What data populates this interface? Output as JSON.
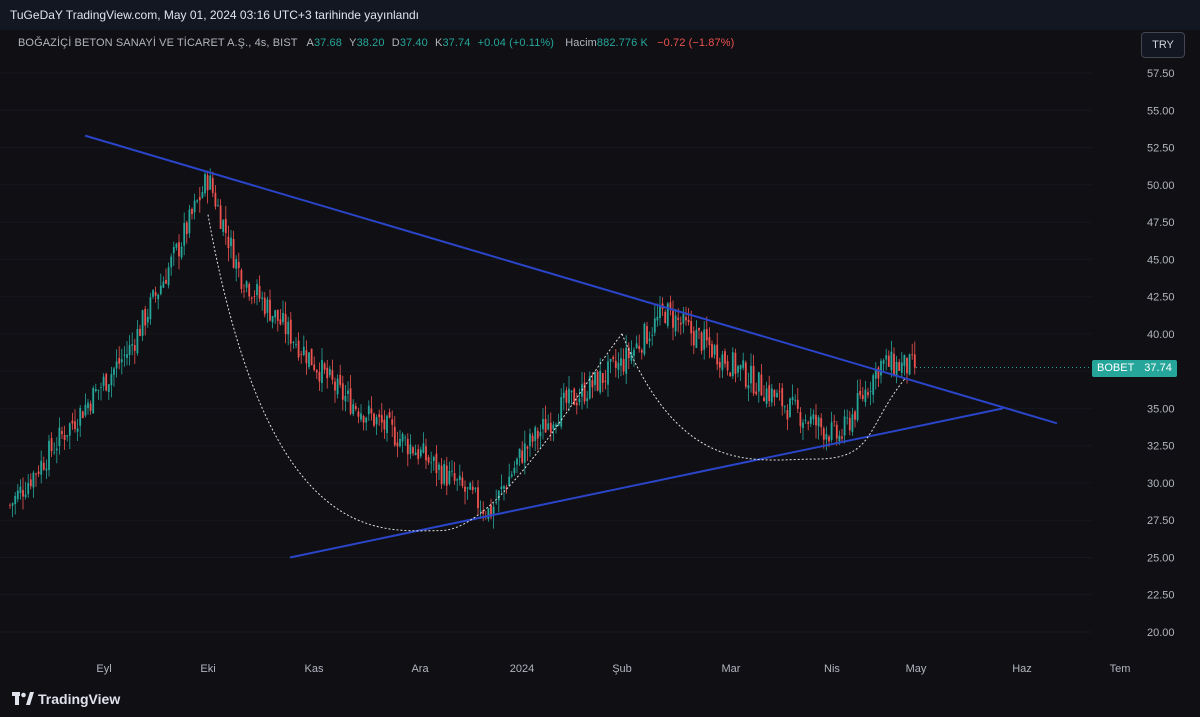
{
  "header": {
    "publish_line": "TuGeDaY TradingView.com, May 01, 2024 03:16 UTC+3 tarihinde yayınlandı"
  },
  "legend": {
    "title": "BOĞAZİÇİ BETON SANAYİ VE TİCARET A.Ş., 4s, BIST",
    "open_label": "A",
    "open_value": "37.68",
    "high_label": "Y",
    "high_value": "38.20",
    "low_label": "D",
    "low_value": "37.40",
    "close_label": "K",
    "close_value": "37.74",
    "change": "+0.04 (+0.11%)",
    "volume_label": "Hacim",
    "volume_value": "882.776 K",
    "volume_change": "−0.72 (−1.87%)"
  },
  "currency_button": "TRY",
  "price_tag": {
    "symbol": "BOBET",
    "price": "37.74"
  },
  "footer": {
    "brand": "TradingView"
  },
  "colors": {
    "background": "#0f0f14",
    "up_candle": "#26a69a",
    "down_candle": "#ef5350",
    "trendline": "#2a45c8",
    "arc": "#e0e0e0"
  },
  "chart_data": {
    "type": "candlestick",
    "symbol": "BOBET",
    "interval": "4s",
    "ylim": [
      18.75,
      58.75
    ],
    "y_ticks": [
      "57.50",
      "55.00",
      "52.50",
      "50.00",
      "47.50",
      "45.00",
      "42.50",
      "40.00",
      "37.50",
      "35.00",
      "32.50",
      "30.00",
      "27.50",
      "25.00",
      "22.50",
      "20.00"
    ],
    "x_ticks": [
      "Eyl",
      "Eki",
      "Kas",
      "Ara",
      "2024",
      "Şub",
      "Mar",
      "Nis",
      "May",
      "Haz",
      "Tem"
    ],
    "price_path": [
      {
        "t": "start",
        "p": 28.5
      },
      {
        "t": "Eyl",
        "p": 33
      },
      {
        "t": "Eyl+",
        "p": 39
      },
      {
        "t": "Eki-",
        "p": 46
      },
      {
        "t": "Eki",
        "p": 50.5
      },
      {
        "t": "Eki+",
        "p": 44
      },
      {
        "t": "Kas",
        "p": 40
      },
      {
        "t": "Kas+",
        "p": 36
      },
      {
        "t": "Ara",
        "p": 32
      },
      {
        "t": "Ara+",
        "p": 28
      },
      {
        "t": "2024",
        "p": 32
      },
      {
        "t": "2024+",
        "p": 35
      },
      {
        "t": "Şub",
        "p": 38
      },
      {
        "t": "Şub+",
        "p": 41.5
      },
      {
        "t": "Mar",
        "p": 38
      },
      {
        "t": "Mar+",
        "p": 35
      },
      {
        "t": "Nis",
        "p": 33
      },
      {
        "t": "Nis+",
        "p": 38
      },
      {
        "t": "end",
        "p": 37.74
      }
    ],
    "trendlines": [
      {
        "name": "descending",
        "from": {
          "x": "Ağu",
          "y": 53.3
        },
        "to": {
          "x": "Haz+",
          "y": 34
        }
      },
      {
        "name": "ascending",
        "from": {
          "x": "Kas",
          "y": 25
        },
        "to": {
          "x": "Haz",
          "y": 35
        }
      }
    ],
    "arcs": [
      {
        "name": "cup",
        "from": {
          "x": "Eki",
          "y": 48
        },
        "bottom": {
          "x": "Ara",
          "y": 26.8
        },
        "to": {
          "x": "Şub",
          "y": 40
        }
      },
      {
        "name": "handle",
        "from": {
          "x": "Şub",
          "y": 40
        },
        "bottom": {
          "x": "Nis",
          "y": 31.6
        },
        "to": {
          "x": "May",
          "y": 37
        }
      }
    ],
    "last_price": 37.74
  }
}
